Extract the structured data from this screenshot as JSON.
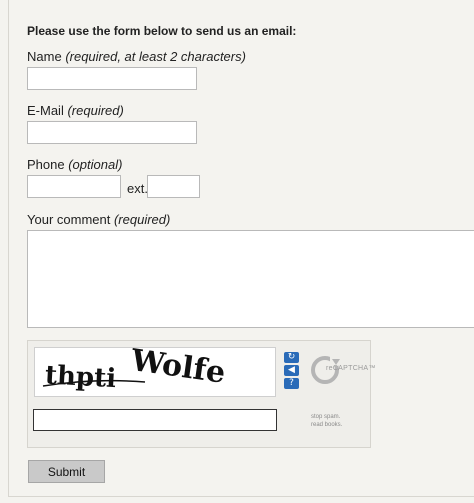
{
  "form": {
    "intro": "Please use the form below to send us an email:",
    "name": {
      "label": "Name",
      "hint": "(required, at least 2 characters)",
      "value": ""
    },
    "email": {
      "label": "E-Mail",
      "hint": "(required)",
      "value": ""
    },
    "phone": {
      "label": "Phone",
      "hint": "(optional)",
      "value": "",
      "ext_label": "ext.",
      "ext_value": ""
    },
    "comment": {
      "label": "Your comment",
      "hint": "(required)",
      "value": ""
    },
    "submit_label": "Submit"
  },
  "captcha": {
    "words": [
      "thpti",
      "Wolfe"
    ],
    "brand": "reCAPTCHA™",
    "slogan_line1": "stop spam.",
    "slogan_line2": "read books.",
    "response_value": "",
    "controls": [
      "refresh-icon",
      "audio-icon",
      "help-icon"
    ]
  }
}
